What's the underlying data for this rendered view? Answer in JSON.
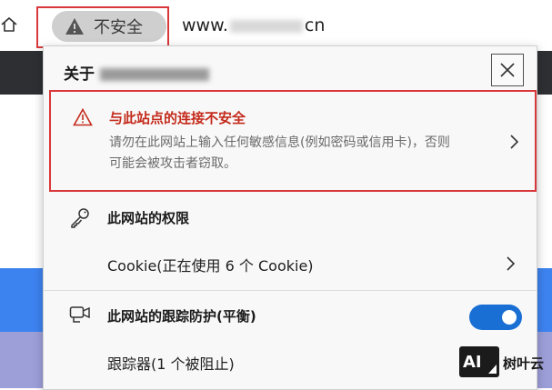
{
  "address_bar": {
    "insecure_label": "不安全",
    "url_prefix": "www.",
    "url_suffix": "cn"
  },
  "popup": {
    "title_prefix": "关于",
    "warning": {
      "heading": "与此站点的连接不安全",
      "description": "请勿在此网站上输入任何敏感信息(例如密码或信用卡)，否则可能会被攻击者窃取。"
    },
    "permissions": {
      "heading": "此网站的权限",
      "cookie_label": "Cookie(正在使用 6 个 Cookie)"
    },
    "tracking": {
      "heading": "此网站的跟踪防护(平衡)",
      "enabled": true,
      "trackers_label": "跟踪器(1 个被阻止)"
    }
  },
  "watermark": {
    "logo": "AI",
    "text": "树叶云"
  },
  "colors": {
    "accent": "#1a6fd4",
    "warning_red": "#c42b1c",
    "highlight_box": "#d9383b"
  }
}
